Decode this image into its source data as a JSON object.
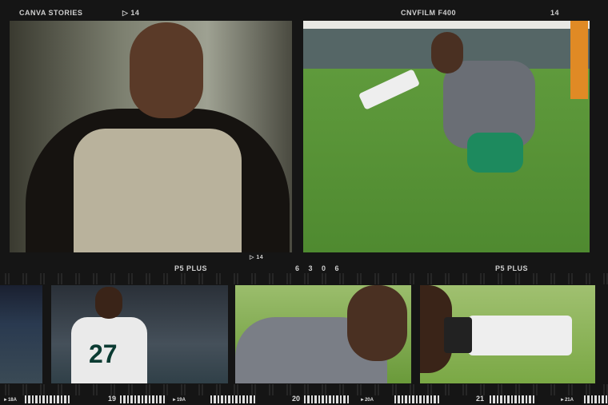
{
  "top_strip": {
    "brand": "CANVA STORIES",
    "frame_left": "14",
    "film": "CNVFILM F400",
    "frame_right": "14"
  },
  "middle_strip": {
    "frame_marker": "14",
    "stock_left": "P5 PLUS",
    "code": "6 3 0 6",
    "stock_right": "P5 PLUS"
  },
  "bottom_strip": {
    "frames": [
      "►18A",
      "19",
      "►19A",
      "20",
      "►20A",
      "21",
      "►21A"
    ]
  },
  "photos": {
    "jersey_number": "27"
  }
}
